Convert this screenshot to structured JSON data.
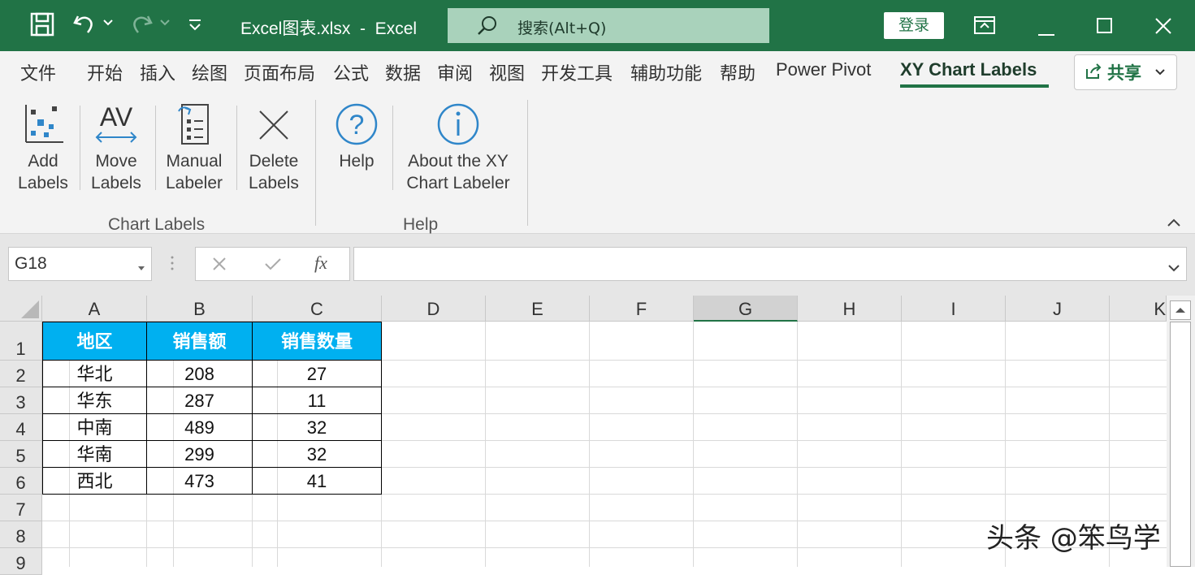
{
  "titlebar": {
    "title": "Excel图表.xlsx  -  Excel",
    "search": "搜索(Alt+Q)",
    "login": "登录"
  },
  "tabs": [
    "文件",
    "开始",
    "插入",
    "绘图",
    "页面布局",
    "公式",
    "数据",
    "审阅",
    "视图",
    "开发工具",
    "辅助功能",
    "帮助",
    "Power Pivot",
    "XY Chart Labels"
  ],
  "share": "共享",
  "ribbon": {
    "buttons": {
      "add_labels": "Add\nLabels",
      "move_labels": "Move\nLabels",
      "manual_labeler": "Manual\nLabeler",
      "delete_labels": "Delete\nLabels",
      "help": "Help",
      "about": "About the XY\nChart Labeler"
    },
    "groups": {
      "chart_labels": "Chart Labels",
      "help": "Help"
    }
  },
  "formula_bar": {
    "name_box": "G18",
    "fx": "fx",
    "formula": ""
  },
  "columns": [
    "A",
    "B",
    "C",
    "D",
    "E",
    "F",
    "G",
    "H",
    "I",
    "J",
    "K"
  ],
  "rows": [
    "1",
    "2",
    "3",
    "4",
    "5",
    "6",
    "7",
    "8",
    "9"
  ],
  "table": {
    "headers": [
      "地区",
      "销售额",
      "销售数量"
    ],
    "rows": [
      [
        "华北",
        "208",
        "27"
      ],
      [
        "华东",
        "287",
        "11"
      ],
      [
        "中南",
        "489",
        "32"
      ],
      [
        "华南",
        "299",
        "32"
      ],
      [
        "西北",
        "473",
        "41"
      ]
    ]
  },
  "watermark": "头条 @笨鸟学",
  "colors": {
    "excel_green": "#217346",
    "header_fill": "#00b0f0"
  }
}
